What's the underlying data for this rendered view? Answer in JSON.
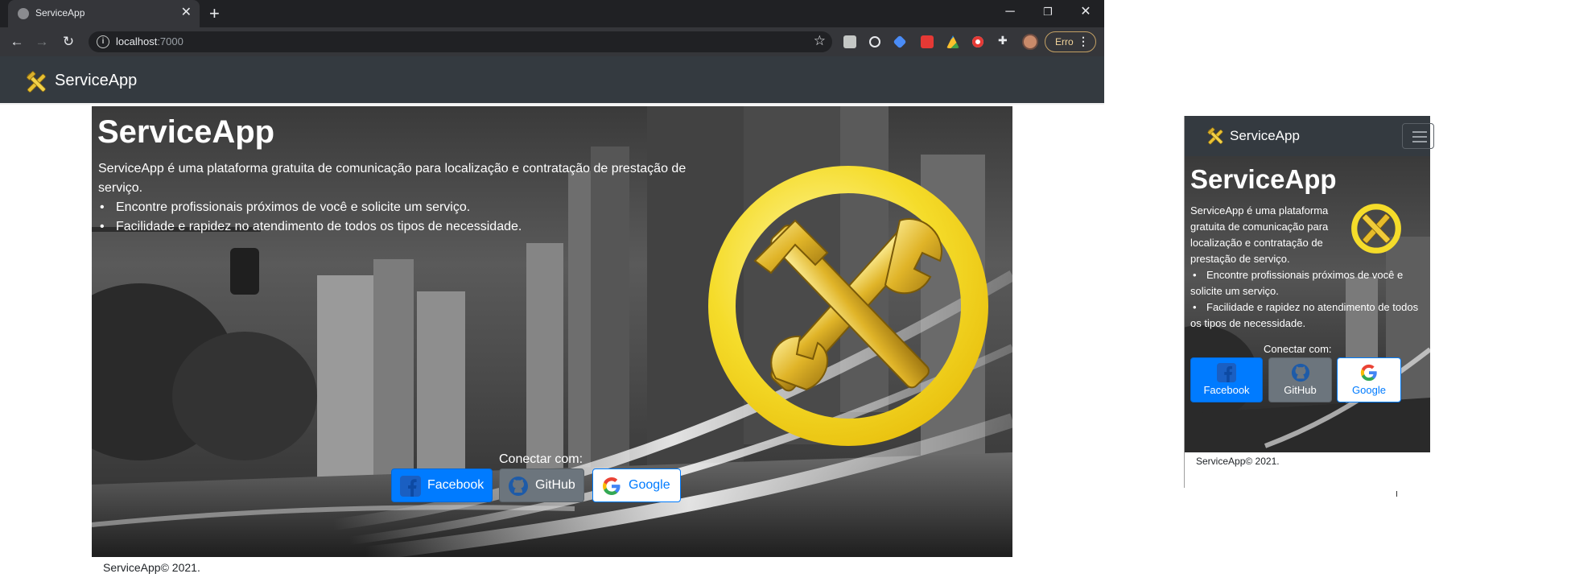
{
  "browser": {
    "tab_title": "ServiceApp",
    "tab_close": "✕",
    "new_tab": "+",
    "window_controls": {
      "minimize": "─",
      "restore": "❐",
      "close": "✕"
    },
    "url_host": "localhost",
    "url_port": ":7000",
    "profile_button_label": "Erro",
    "icons": [
      "back-icon",
      "forward-icon",
      "reload-icon",
      "info-icon",
      "bookmark-star-icon",
      "extensions-puzzle-icon",
      "menu-dots-icon"
    ]
  },
  "navbar": {
    "brand": "ServiceApp"
  },
  "hero": {
    "title": "ServiceApp",
    "description": "ServiceApp é uma plataforma gratuita de comunicação para localização e contratação de prestação de serviço.",
    "features": [
      "Encontre profissionais próximos de você e solicite um serviço.",
      "Facilidade e rapidez no atendimento de todos os tipos de necessidade."
    ],
    "connect_label": "Conectar com:",
    "buttons": {
      "facebook": "Facebook",
      "github": "GitHub",
      "google": "Google"
    }
  },
  "footer": {
    "text": "ServiceApp© 2021."
  },
  "mobile": {
    "brand": "ServiceApp",
    "title": "ServiceApp",
    "description": "ServiceApp é uma plataforma gratuita de comunicação para localização e contratação de prestação de serviço.",
    "features": [
      "Encontre profissionais próximos de você e solicite um serviço.",
      "Facilidade e rapidez no atendimento de todos os tipos de necessidade."
    ],
    "connect_label": "Conectar com:",
    "buttons": {
      "facebook": "Facebook",
      "github": "GitHub",
      "google": "Google"
    },
    "footer": "ServiceApp© 2021."
  },
  "colors": {
    "navbar": "#343a40",
    "facebook": "#007bff",
    "github": "#6c757d",
    "google_outline": "#007bff",
    "logo_gold": "#f5dc2a"
  }
}
